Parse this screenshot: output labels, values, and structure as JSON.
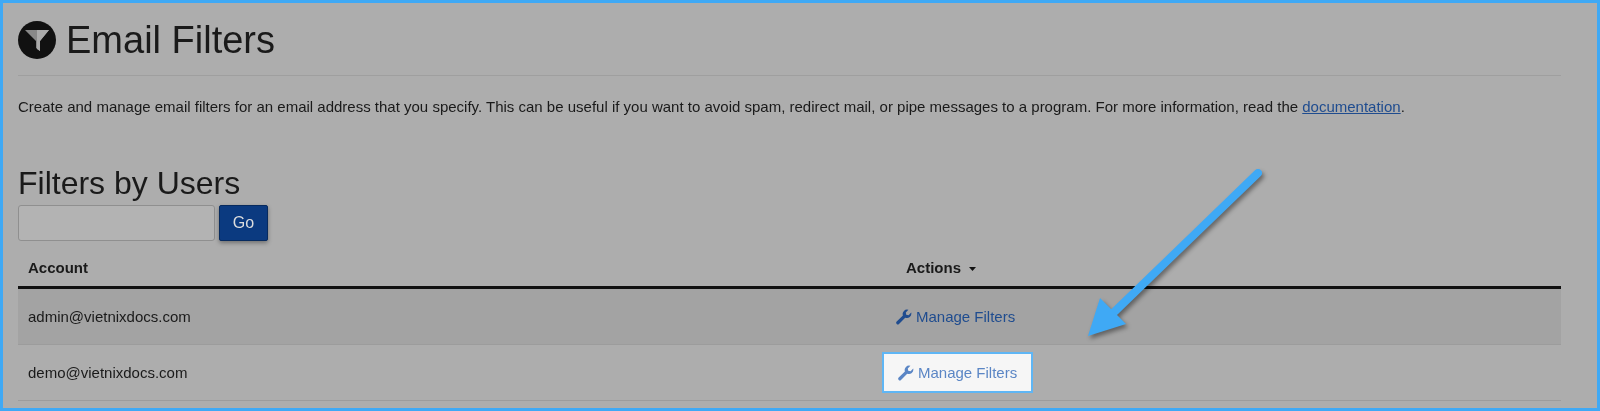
{
  "page": {
    "title": "Email Filters"
  },
  "description": {
    "text": "Create and manage email filters for an email address that you specify. This can be useful if you want to avoid spam, redirect mail, or pipe messages to a program. For more information, read the ",
    "link": "documentation",
    "end": "."
  },
  "section": {
    "title": "Filters by Users"
  },
  "search": {
    "button": "Go"
  },
  "table": {
    "columns": [
      {
        "label": "Account",
        "dropdown": false
      },
      {
        "label": "Actions",
        "dropdown": true
      }
    ],
    "rows": [
      {
        "account": "admin@vietnixdocs.com",
        "action": "Manage Filters",
        "highlighted": false
      },
      {
        "account": "demo@vietnixdocs.com",
        "action": "Manage Filters",
        "highlighted": true
      }
    ]
  }
}
